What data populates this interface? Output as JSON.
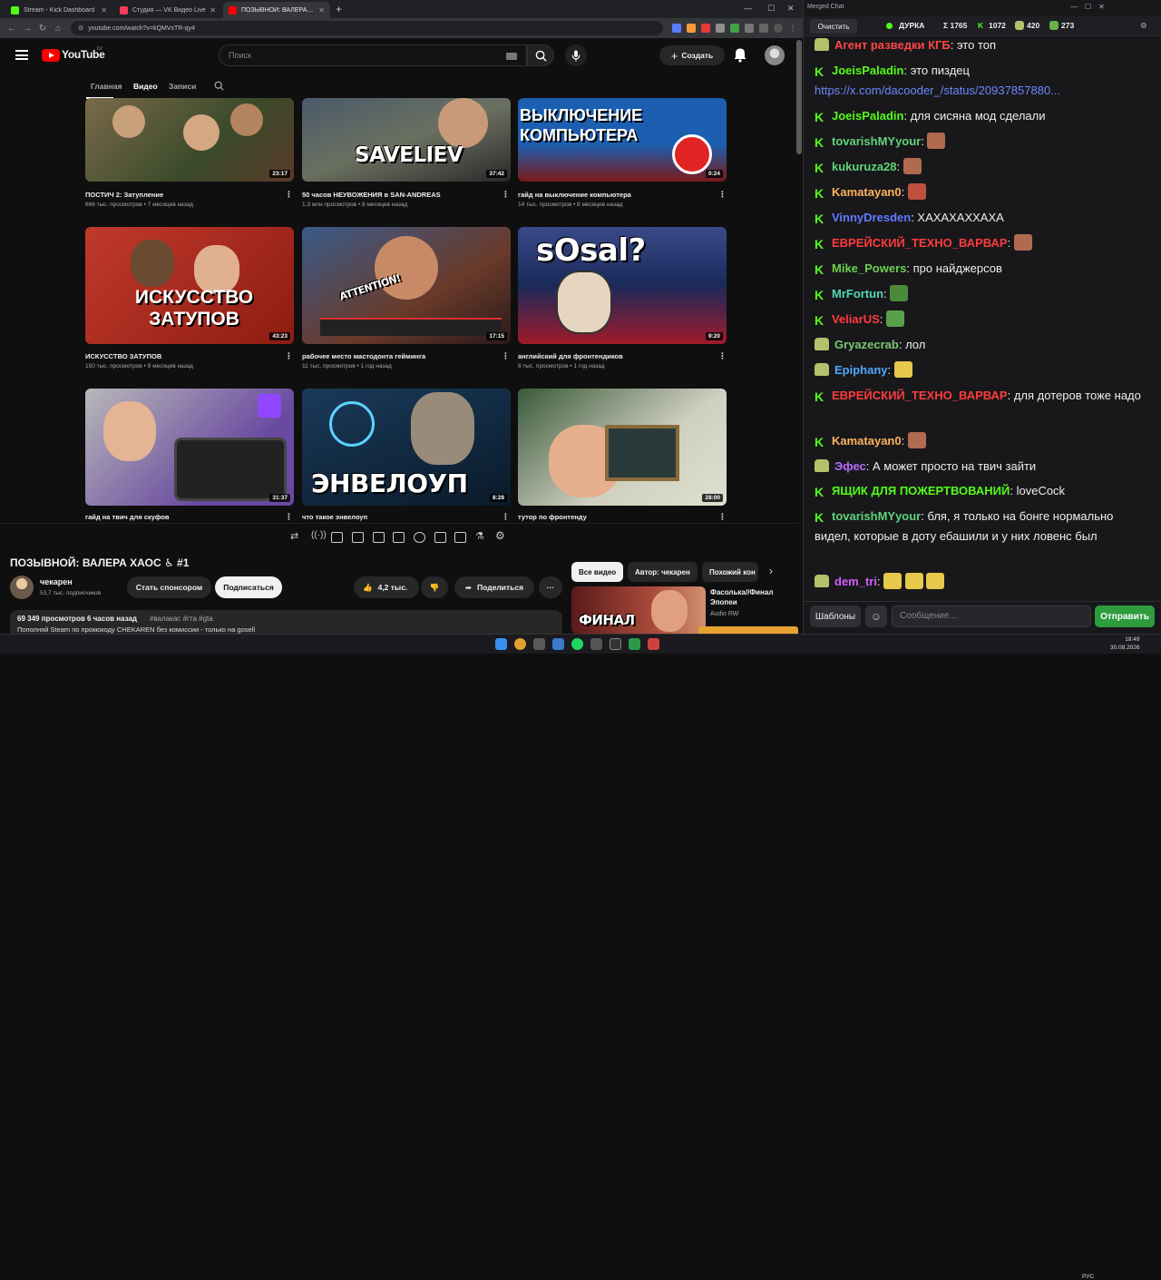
{
  "browser": {
    "tabs": [
      {
        "label": "Stream - Kick Dashboard",
        "color": "#53fc18"
      },
      {
        "label": "Студия — VK Видео Live",
        "color": "#ff3b5c"
      },
      {
        "label": "ПОЗЫВНОЙ: ВАЛЕРА ХАОС",
        "color": "#ff0000"
      }
    ],
    "url": "youtube.com/watch?v=kQMVxTR-qy4"
  },
  "youtube": {
    "logo_text": "YouTube",
    "country": "LV",
    "search_placeholder": "Поиск",
    "create_label": "Создать",
    "channel_tabs": [
      "Главная",
      "Видео",
      "Записи"
    ],
    "videos": [
      {
        "title": "ПОСТИЧ 2: Затупление",
        "meta": "666 тыс. просмотров • 7 месяцев назад",
        "duration": "23:17"
      },
      {
        "title": "50 часов НЕУВОЖЕНИЯ в SAN-ANDREAS",
        "meta": "1,3 млн просмотров • 8 месяцев назад",
        "duration": "37:42",
        "overlay": "SAVELIEV"
      },
      {
        "title": "гайд на выключение компьютера",
        "meta": "14 тыс. просмотров • 8 месяцев назад",
        "duration": "0:24",
        "overlay": "ВЫКЛЮЧЕНИЕ КОМПЬЮТЕРА"
      },
      {
        "title": "ИСКУССТВО ЗАТУПОВ",
        "meta": "150 тыс. просмотров • 9 месяцев назад",
        "duration": "43:23",
        "overlay": "ИСКУССТВО ЗАТУПОВ"
      },
      {
        "title": "рабочее место мастодонта гейминга",
        "meta": "11 тыс. просмотров • 1 год назад",
        "duration": "17:15",
        "overlay": "ATTENTION!"
      },
      {
        "title": "английский для фронтендиков",
        "meta": "6 тыс. просмотров • 1 год назад",
        "duration": "9:20",
        "overlay": "sOsal?"
      },
      {
        "title": "гайд на твич для скуфов",
        "meta": "",
        "duration": "31:37"
      },
      {
        "title": "что такое энвелоуп",
        "meta": "",
        "duration": "8:28",
        "overlay": "ЭНВЕЛОУП"
      },
      {
        "title": "тутор по фронтенду",
        "meta": "",
        "duration": "28:00"
      }
    ],
    "video_title": "ПОЗЫВНОЙ: ВАЛЕРА ХАОС ♿ #1",
    "channel_name": "чекарен",
    "subscribers": "53,7 тыс. подписчиков",
    "sponsor_label": "Стать спонсором",
    "subscribe_label": "Подписаться",
    "likes": "4,2 тыс.",
    "share_label": "Поделиться",
    "desc_meta": "69 349 просмотров  6 часов назад",
    "desc_tags": "#валакас #гта #gta",
    "desc_line": "Пополняй Steam по промокоду CHEKAREN без комиссии - только на gosell",
    "filters": [
      "Все видео",
      "Автор: чекарен",
      "Похожий кон"
    ],
    "side_title": "Фасолька//Финал Эпопеи",
    "side_channel": "Audio RW",
    "side_thumb_text": "ФИНАЛ"
  },
  "chat": {
    "title": "Merged Chat",
    "clear_label": "Очистить",
    "channel": "ДУРКА",
    "total": "Σ 1765",
    "kick_count": "1072",
    "twitch_count": "420",
    "vk_count": "273",
    "messages": [
      {
        "src": "twitch",
        "user": "Агент разведки КГБ",
        "color": "#ff4545",
        "text": "это топ"
      },
      {
        "src": "kick",
        "user": "JoeisPaladin",
        "color": "#53fc18",
        "text": "это пиздец"
      },
      {
        "src": "link",
        "text": "https://x.com/dacooder_/status/20937857880..."
      },
      {
        "src": "kick",
        "user": "JoeisPaladin",
        "color": "#53fc18",
        "text": "для сисяна мод сделали"
      },
      {
        "src": "kick",
        "user": "tovarishMYyour",
        "color": "#5fd47a",
        "text": "",
        "emote": "#b06a50"
      },
      {
        "src": "kick",
        "user": "kukuruza28",
        "color": "#5fd47a",
        "text": "",
        "emote": "#b06a50"
      },
      {
        "src": "kick",
        "user": "Kamatayan0",
        "color": "#ffb35c",
        "text": "",
        "emote": "#c05040"
      },
      {
        "src": "kick",
        "user": "VinnyDresden",
        "color": "#5f7bff",
        "text": "ХАХАХАХХАХА"
      },
      {
        "src": "kick",
        "user": "ЕВРЕЙСКИЙ_ТЕХНО_ВАРВАР",
        "color": "#ff3b3b",
        "text": "",
        "emote": "#b06a50"
      },
      {
        "src": "kick",
        "user": "Mike_Powers",
        "color": "#6bd14f",
        "text": "про найджерсов"
      },
      {
        "src": "kick",
        "user": "MrFortun",
        "color": "#53d6b0",
        "text": "",
        "emote": "#4c8a3a"
      },
      {
        "src": "kick",
        "user": "VeliarUS",
        "color": "#ff3b3b",
        "text": "",
        "emote": "#5aa04a"
      },
      {
        "src": "twitch",
        "user": "Gryazecrab",
        "color": "#7bc96f",
        "text": "лол"
      },
      {
        "src": "twitch",
        "user": "Epiphany",
        "color": "#4fa8ff",
        "text": "",
        "emote": "#e6c84a"
      },
      {
        "src": "kick",
        "user": "ЕВРЕЙСКИЙ_ТЕХНО_ВАРВАР",
        "color": "#ff3b3b",
        "text": "для дотеров тоже надо"
      },
      {
        "src": "kick",
        "user": "Kamatayan0",
        "color": "#ffb35c",
        "text": "",
        "emote": "#b06a50"
      },
      {
        "src": "twitch",
        "user": "Эфес",
        "color": "#b86bff",
        "text": "А может просто на твич зайти"
      },
      {
        "src": "kick",
        "user": "ЯЩИК ДЛЯ ПОЖЕРТВОВАНИЙ",
        "color": "#53fc18",
        "text": "loveCock"
      },
      {
        "src": "kick",
        "user": "tovarishMYyour",
        "color": "#5fd47a",
        "text": "бля, я только на бонге нормально видел, которые в доту ебашили и у них ловенс был"
      },
      {
        "src": "twitch",
        "user": "dem_tri",
        "color": "#d55cff",
        "text": "",
        "emote": "#e6c84a"
      }
    ],
    "templates_label": "Шаблоны",
    "input_placeholder": "Сообщение...",
    "send_label": "Отправить"
  },
  "taskbar": {
    "lang": "РУС",
    "time": "18:49",
    "date": "30.08.2026"
  }
}
